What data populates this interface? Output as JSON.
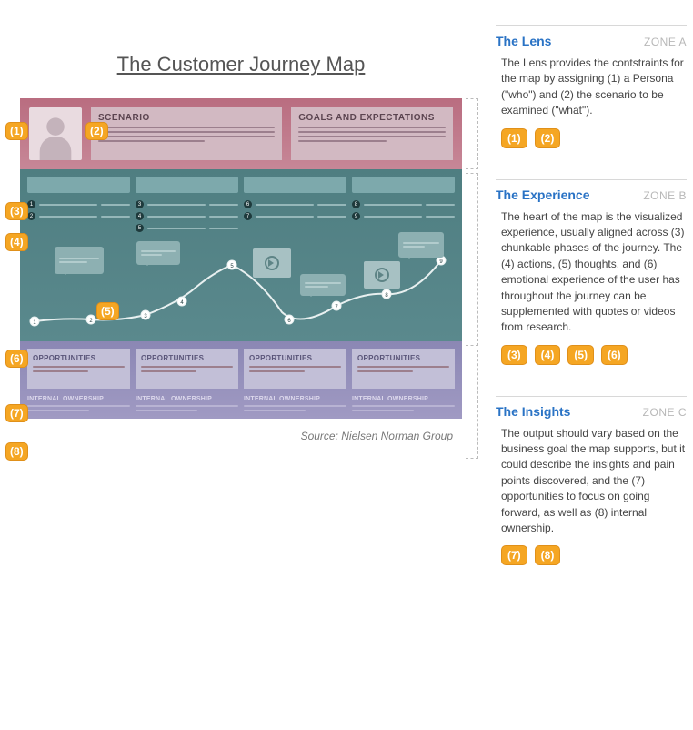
{
  "title": "The Customer Journey Map",
  "source": "Source: Nielsen Norman Group",
  "markers": [
    "(1)",
    "(2)",
    "(3)",
    "(4)",
    "(5)",
    "(6)",
    "(7)",
    "(8)"
  ],
  "map": {
    "lens": {
      "scenario_label": "SCENARIO",
      "goals_label": "GOALS AND EXPECTATIONS"
    },
    "experience": {
      "action_numbers": [
        "1",
        "2",
        "3",
        "4",
        "5",
        "6",
        "7",
        "8",
        "9"
      ]
    },
    "insights": {
      "opportunities_label": "OPPORTUNITIES",
      "ownership_label": "INTERNAL OWNERSHIP",
      "columns": 4
    }
  },
  "zones": [
    {
      "title": "The Lens",
      "label": "ZONE A",
      "desc": "The Lens provides the contstraints for the map by assigning (1) a Persona (\"who\") and (2) the scenario to be examined (\"what\").",
      "chips": [
        "(1)",
        "(2)"
      ]
    },
    {
      "title": "The Experience",
      "label": "ZONE B",
      "desc": "The heart of the map is the visualized experience, usually aligned across (3) chunkable phases of the journey. The (4) actions, (5) thoughts, and (6) emotional experience of the user has throughout the journey can be supplemented with quotes or videos from research.",
      "chips": [
        "(3)",
        "(4)",
        "(5)",
        "(6)"
      ]
    },
    {
      "title": "The Insights",
      "label": "ZONE C",
      "desc": "The output should vary based on the business goal the map supports, but it could describe the insights and pain points discovered, and the (7) opportunities to focus on going forward, as well as (8) internal ownership.",
      "chips": [
        "(7)",
        "(8)"
      ]
    }
  ]
}
